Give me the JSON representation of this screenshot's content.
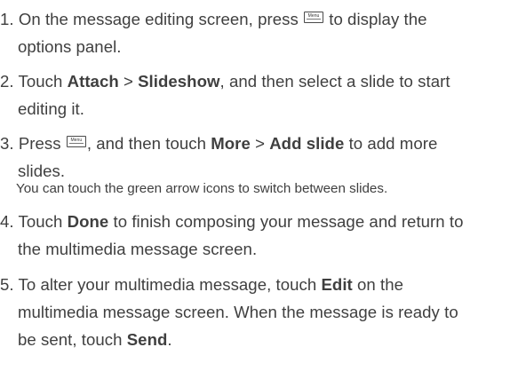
{
  "key_label": "Menu",
  "steps": [
    {
      "num": "1.",
      "a": "On the message editing screen, press",
      "b": "to display the",
      "c": "options panel."
    },
    {
      "num": "2.",
      "a": "Touch",
      "attach": "Attach",
      "sep": ">",
      "slideshow": "Slideshow",
      "b": ", and then select a slide to start",
      "c": "editing it."
    },
    {
      "num": "3.",
      "a": "Press",
      "b": ", and then touch",
      "more": "More",
      "sep": ">",
      "add_slide": "Add slide",
      "c": "to add more",
      "d": "slides.",
      "note": "You can touch the green arrow icons to switch between slides."
    },
    {
      "num": "4.",
      "a": "Touch",
      "done": "Done",
      "b": "to finish composing your message and return to",
      "c": "the multimedia message screen."
    },
    {
      "num": "5.",
      "a": "To alter your multimedia message, touch",
      "edit": "Edit",
      "b": "on the",
      "c": "multimedia message screen. When the message is ready to",
      "d": "be sent, touch",
      "send": "Send",
      "e": "."
    }
  ]
}
